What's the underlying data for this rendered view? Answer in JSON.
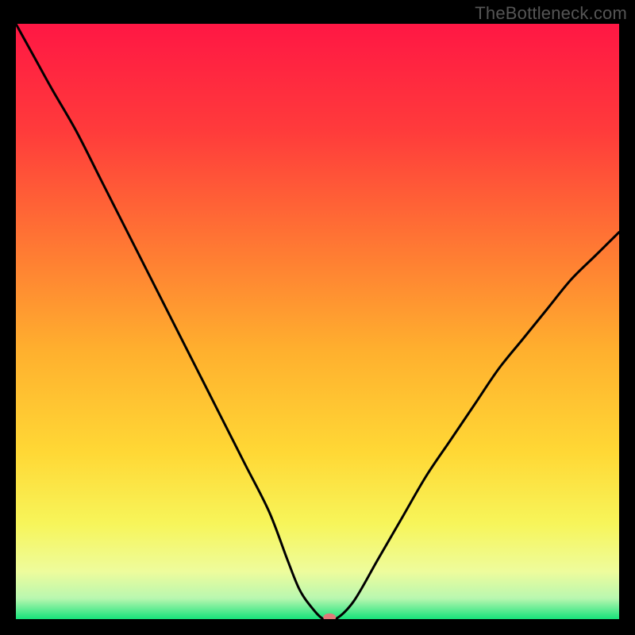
{
  "watermark": "TheBottleneck.com",
  "chart_data": {
    "type": "line",
    "title": "",
    "xlabel": "",
    "ylabel": "",
    "xlim": [
      0,
      100
    ],
    "ylim": [
      0,
      100
    ],
    "gradient_stops": [
      {
        "offset": 0.0,
        "color": "#ff1744"
      },
      {
        "offset": 0.18,
        "color": "#ff3b3b"
      },
      {
        "offset": 0.38,
        "color": "#ff7a33"
      },
      {
        "offset": 0.55,
        "color": "#ffb02e"
      },
      {
        "offset": 0.72,
        "color": "#ffd835"
      },
      {
        "offset": 0.84,
        "color": "#f7f55a"
      },
      {
        "offset": 0.92,
        "color": "#eefc9c"
      },
      {
        "offset": 0.965,
        "color": "#b9f7b0"
      },
      {
        "offset": 1.0,
        "color": "#16e27a"
      }
    ],
    "series": [
      {
        "name": "bottleneck-curve",
        "x": [
          0,
          3,
          6,
          10,
          14,
          18,
          22,
          26,
          30,
          34,
          38,
          42,
          45,
          47,
          49,
          51,
          53,
          56,
          60,
          64,
          68,
          72,
          76,
          80,
          84,
          88,
          92,
          96,
          100
        ],
        "y": [
          0,
          5.5,
          11,
          18,
          26,
          34,
          42,
          50,
          58,
          66,
          74,
          82,
          90,
          95,
          98,
          100,
          100,
          97,
          90,
          83,
          76,
          70,
          64,
          58,
          53,
          48,
          43,
          39,
          35
        ]
      }
    ],
    "marker": {
      "x": 52,
      "y": 99.7,
      "color": "#e07a7a",
      "rx": 8,
      "ry": 5
    }
  }
}
